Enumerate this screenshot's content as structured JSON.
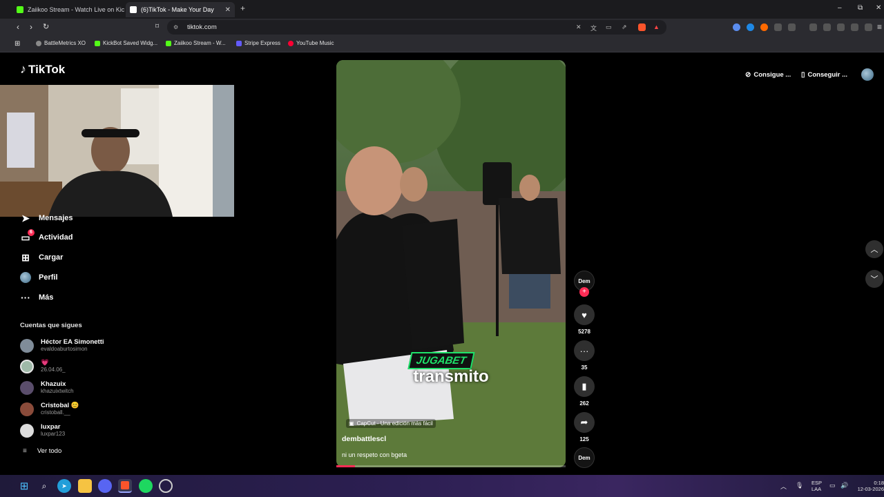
{
  "browser": {
    "tabs": [
      {
        "title": "Zaiikoo Stream - Watch Live on Kick",
        "active": false,
        "favicon_color": "#53fc18"
      },
      {
        "title": "(6)TikTok - Make Your Day",
        "active": true,
        "favicon_color": "#ffffff"
      }
    ],
    "url": "tiktok.com",
    "bookmarks": [
      {
        "label": "BattleMetrics XO",
        "color": "#8a8a8a"
      },
      {
        "label": "KickBot Saved Widg...",
        "color": "#53fc18"
      },
      {
        "label": "Zaiikoo Stream - W...",
        "color": "#53fc18"
      },
      {
        "label": "Stripe Express",
        "color": "#635bff"
      },
      {
        "label": "YouTube Music",
        "color": "#ff0033"
      }
    ],
    "window_controls": [
      "–",
      "⧉",
      "✕"
    ]
  },
  "tiktok": {
    "logo": "TikTok",
    "header_pills": [
      "Consigue ...",
      "Conseguir ..."
    ],
    "sidebar": [
      {
        "label": "Mensajes",
        "icon": "send-icon"
      },
      {
        "label": "Actividad",
        "icon": "inbox-icon",
        "badge": "6"
      },
      {
        "label": "Cargar",
        "icon": "upload-icon"
      },
      {
        "label": "Perfil",
        "icon": "profile-avatar"
      },
      {
        "label": "Más",
        "icon": "more-icon"
      }
    ],
    "following_title": "Cuentas que sigues",
    "following": [
      {
        "name": "Héctor EA Simonetti",
        "handle": "evaldoaburtosimon",
        "color": "#7f8c99"
      },
      {
        "name": "💗",
        "handle": "26.04.06_",
        "color": "#9fb9a8"
      },
      {
        "name": "Khazuix",
        "handle": "khazuixtwitch",
        "color": "#5a4d6b"
      },
      {
        "name": "Cristobal 😊",
        "handle": "cristoball.__",
        "color": "#8a4b3a"
      },
      {
        "name": "luxpar",
        "handle": "luxpar123",
        "color": "#dcdcdc"
      }
    ],
    "see_all": "Ver todo",
    "video": {
      "brand_text": "JUGABET",
      "caption_text": "transmito",
      "capcut": "CapCut - Una edición más fácil",
      "author": "dembattlescl",
      "description": "ni un respeto con bgeta",
      "progress": 0.08
    },
    "actions": {
      "author_badge": "Dem",
      "likes": "5278",
      "comments": "35",
      "saves": "262",
      "shares": "125"
    }
  },
  "taskbar": {
    "lang1": "ESP",
    "lang2": "LAA",
    "time": "0:18",
    "date": "12-03-2026"
  }
}
